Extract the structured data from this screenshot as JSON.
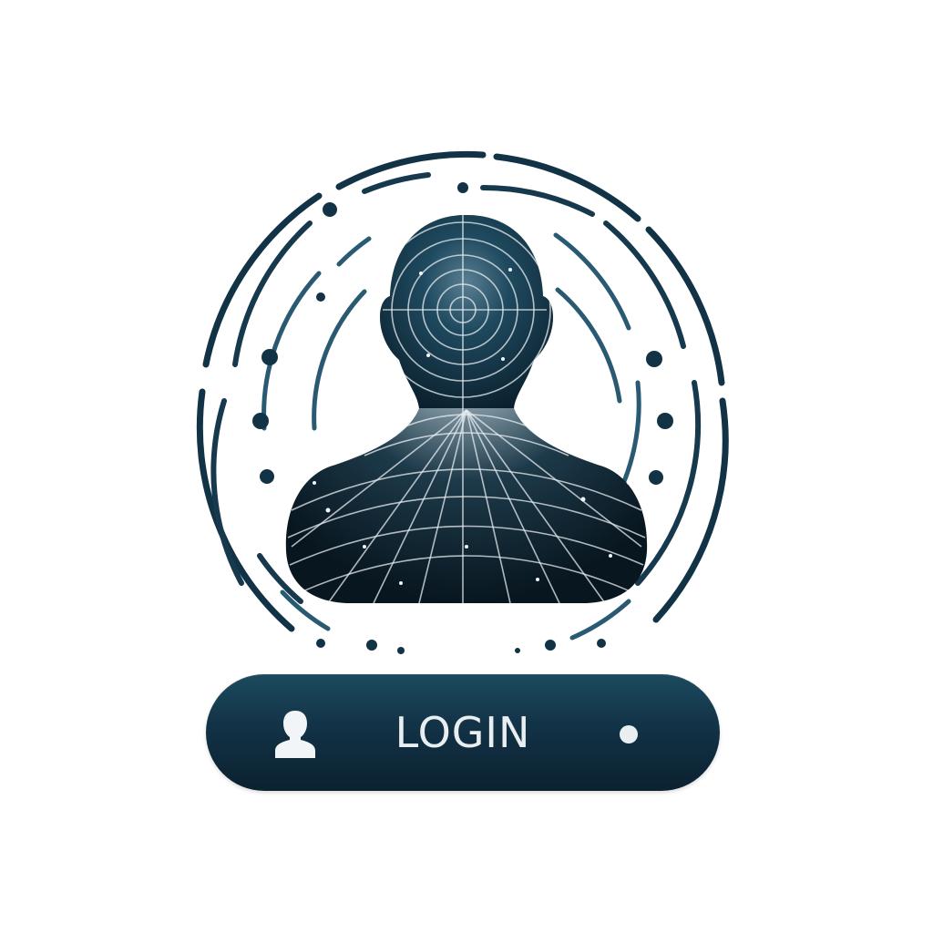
{
  "login": {
    "label": "LOGIN",
    "icon": "user-icon",
    "indicator": "dot-icon"
  },
  "emblem": {
    "icon": "face-scan-icon"
  },
  "colors": {
    "primary": "#123246",
    "dark": "#0b2130",
    "accent": "#3a6a82",
    "text": "#e9eef1",
    "background": "#ffffff"
  }
}
